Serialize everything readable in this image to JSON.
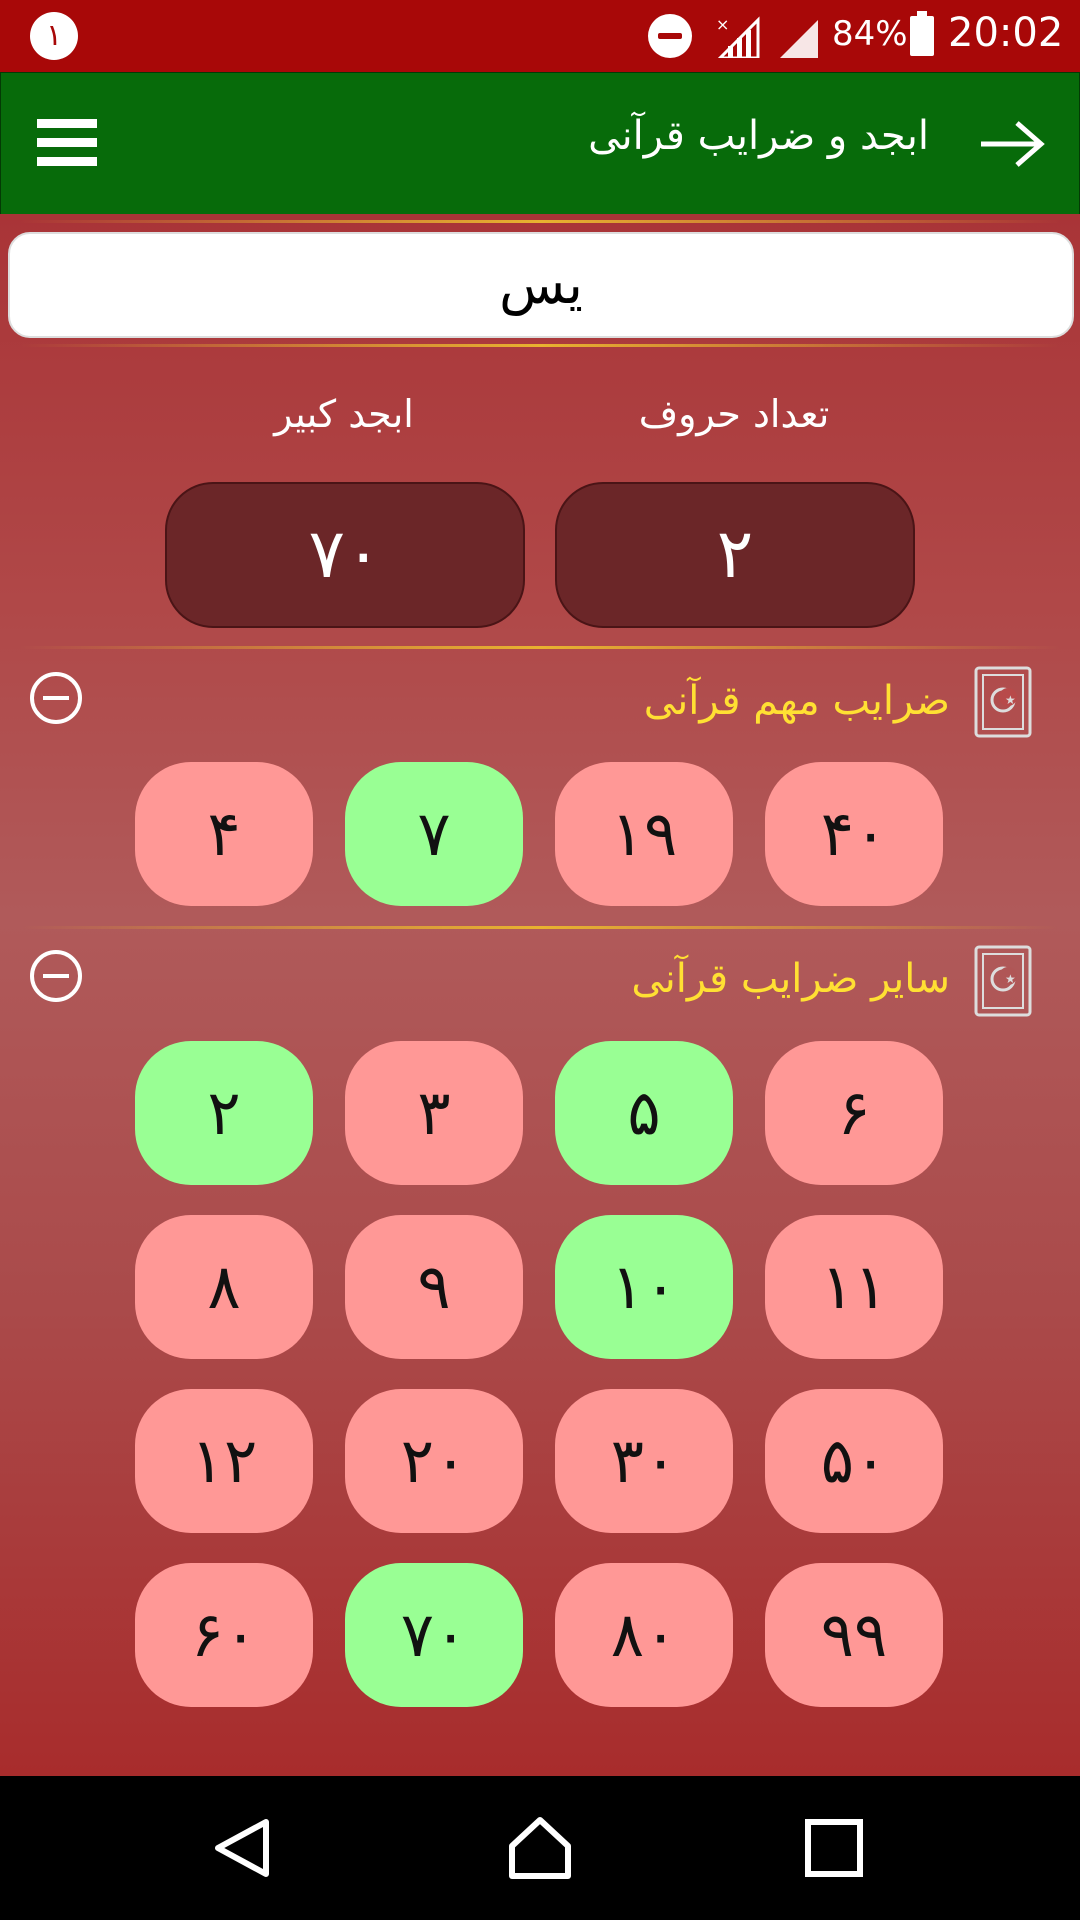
{
  "status_bar": {
    "notification_badge": "١",
    "battery_percent": "84%",
    "time": "20:02"
  },
  "toolbar": {
    "title": "ابجد و ضرایب قرآنی"
  },
  "input": {
    "word": "یس"
  },
  "stats": {
    "letter_count_label": "تعداد حروف",
    "letter_count_value": "٢",
    "abjad_label": "ابجد کبیر",
    "abjad_value": "٧٠"
  },
  "important_section": {
    "title": "ضرایب مهم قرآنی",
    "items": [
      {
        "label": "۴٠",
        "status": "red"
      },
      {
        "label": "١٩",
        "status": "red"
      },
      {
        "label": "٧",
        "status": "green"
      },
      {
        "label": "۴",
        "status": "red"
      }
    ]
  },
  "other_section": {
    "title": "سایر ضرایب قرآنی",
    "items": [
      {
        "label": "۶",
        "status": "red"
      },
      {
        "label": "۵",
        "status": "green"
      },
      {
        "label": "٣",
        "status": "red"
      },
      {
        "label": "٢",
        "status": "green"
      },
      {
        "label": "١١",
        "status": "red"
      },
      {
        "label": "١٠",
        "status": "green"
      },
      {
        "label": "٩",
        "status": "red"
      },
      {
        "label": "٨",
        "status": "red"
      },
      {
        "label": "۵٠",
        "status": "red"
      },
      {
        "label": "٣٠",
        "status": "red"
      },
      {
        "label": "٢٠",
        "status": "red"
      },
      {
        "label": "١٢",
        "status": "red"
      },
      {
        "label": "٩٩",
        "status": "red"
      },
      {
        "label": "٨٠",
        "status": "red"
      },
      {
        "label": "٧٠",
        "status": "green"
      },
      {
        "label": "۶٠",
        "status": "red"
      }
    ]
  },
  "colors": {
    "status_bar": "#a80808",
    "toolbar": "#076b0a",
    "pill_red": "#ff9896",
    "pill_green": "#99ff94",
    "section_title": "#ffe033"
  }
}
